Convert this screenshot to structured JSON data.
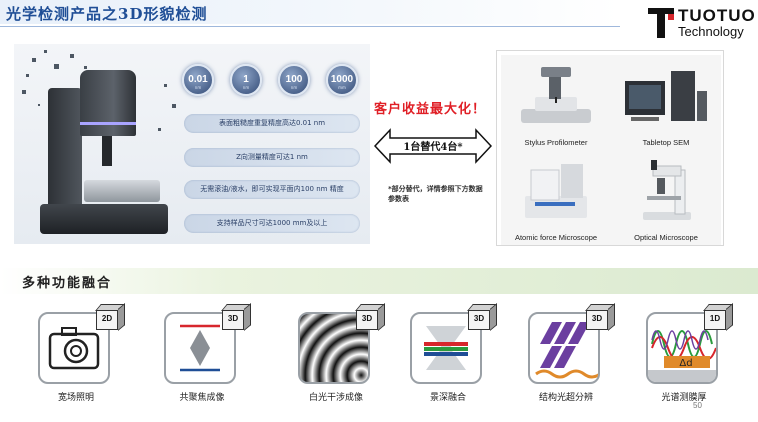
{
  "header": {
    "title": "光学检测产品之3D形貌检测",
    "logo_name": "TUOTUO",
    "logo_sub": "Technology"
  },
  "hero": {
    "badges": [
      {
        "value": "0.01",
        "unit": "nm"
      },
      {
        "value": "1",
        "unit": "nm"
      },
      {
        "value": "100",
        "unit": "nm"
      },
      {
        "value": "1000",
        "unit": "mm"
      }
    ],
    "specs": [
      "表面粗糙度重复精度高达0.01 nm",
      "Z向测量精度可达1 nm",
      "无需滚油/液水，即可实现平面内100 nm 精度",
      "支持样品尺寸可达1000 mm及以上"
    ]
  },
  "comparison": {
    "benefit": "客户收益最大化！",
    "replace": "1台替代4台*",
    "note": "*部分替代，详情参照下方数据参数表"
  },
  "instruments": [
    {
      "label": "Stylus Profilometer"
    },
    {
      "label": "Tabletop SEM"
    },
    {
      "label": "Atomic force Microscope"
    },
    {
      "label": "Optical Microscope"
    }
  ],
  "section2": {
    "title": "多种功能融合",
    "features": [
      {
        "label": "宽场照明",
        "badge": "2D"
      },
      {
        "label": "共聚焦成像",
        "badge": "3D"
      },
      {
        "label": "白光干涉成像",
        "badge": "3D"
      },
      {
        "label": "景深融合",
        "badge": "3D"
      },
      {
        "label": "结构光超分辨",
        "badge": "3D"
      },
      {
        "label": "光谱测膜厚",
        "badge": "1D",
        "glyph": "Δd"
      }
    ]
  },
  "footer": {
    "page_number": "50"
  },
  "colors": {
    "title_blue": "#1f4e96",
    "benefit_red": "#e01f26",
    "logo_red": "#d7262c"
  }
}
